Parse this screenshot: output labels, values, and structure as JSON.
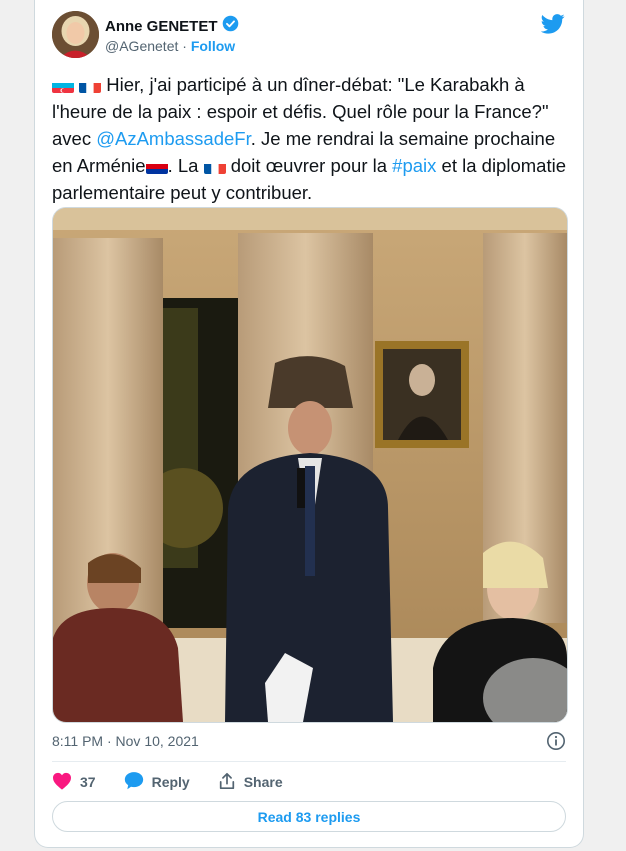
{
  "author": {
    "name": "Anne GENETET",
    "handle": "@AGenetet",
    "separator": "·",
    "follow_label": "Follow"
  },
  "tweet": {
    "text_part1": "Hier, j'ai participé à un dîner-débat: \"Le Karabakh à l'heure de la paix : espoir et défis. Quel rôle pour la France?\" avec ",
    "mention": "@AzAmbassadeFr",
    "text_part2": ". Je me rendrai la semaine prochaine en Arménie",
    "text_part3": ". La ",
    "text_part4": " doit œuvrer pour la ",
    "hashtag": "#paix",
    "text_part5": " et la diplomatie parlementaire peut y contribuer.",
    "timestamp": "8:11 PM · Nov 10, 2021"
  },
  "icons": {
    "verified": "verified-badge-icon",
    "brand": "twitter-bird-icon",
    "info": "info-icon",
    "like": "heart-icon",
    "reply": "reply-bubble-icon",
    "share": "share-icon",
    "flags": [
      "azerbaijan-flag-icon",
      "france-flag-icon",
      "armenia-flag-icon"
    ]
  },
  "actions": {
    "like_count": "37",
    "reply_label": "Reply",
    "share_label": "Share"
  },
  "replies_button": "Read 83 replies",
  "colors": {
    "accent": "#1d9bf0",
    "like": "#f91880",
    "text": "#0f1419",
    "muted": "#536471"
  }
}
